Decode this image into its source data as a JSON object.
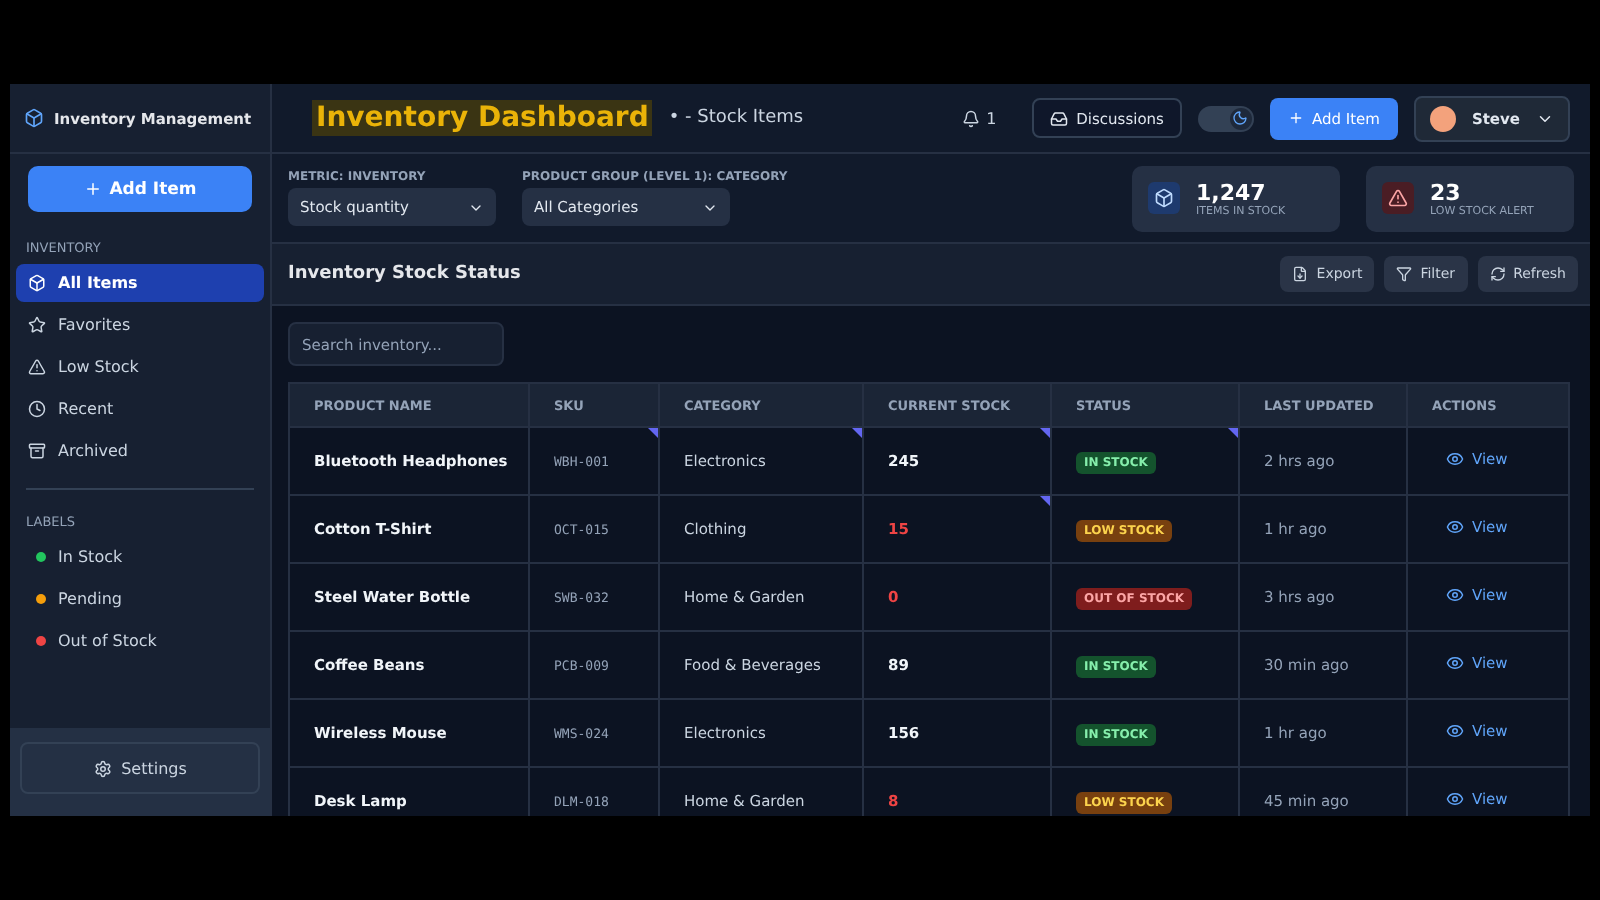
{
  "sidebar": {
    "title": "Inventory Management",
    "add_button": "Add Item",
    "sections": [
      {
        "heading": "INVENTORY",
        "kind": "nav",
        "items": [
          {
            "label": "All Items",
            "selected": true
          },
          {
            "label": "Favorites",
            "selected": false
          },
          {
            "label": "Low Stock",
            "selected": false
          },
          {
            "label": "Recent",
            "selected": false
          },
          {
            "label": "Archived",
            "selected": false
          }
        ]
      },
      {
        "heading": "LABELS",
        "kind": "labels",
        "items": [
          {
            "label": "In Stock",
            "color": "#22c55e"
          },
          {
            "label": "Pending",
            "color": "#f59e0b"
          },
          {
            "label": "Out of Stock",
            "color": "#ef4444"
          }
        ]
      }
    ],
    "settings": "Settings"
  },
  "header": {
    "title": "Inventory Dashboard",
    "subtitle": "• - Stock Items",
    "notifications": "1",
    "discussions": "Discussions",
    "dark_mode": true,
    "add_button": "Add Item",
    "user": "Steve"
  },
  "filters": [
    {
      "label": "METRIC: INVENTORY",
      "value": "Stock quantity"
    },
    {
      "label": "PRODUCT GROUP (LEVEL 1): CATEGORY",
      "value": "All Categories"
    }
  ],
  "stats": [
    {
      "kind": "stock",
      "value": "1,247",
      "label": "ITEMS IN STOCK"
    },
    {
      "kind": "alert",
      "value": "23",
      "label": "LOW STOCK ALERT"
    }
  ],
  "card": {
    "title": "Inventory Stock Status",
    "actions": [
      "Export",
      "Filter",
      "Refresh"
    ],
    "search": {
      "placeholder": "Search inventory..."
    }
  },
  "table": {
    "columns": [
      "PRODUCT NAME",
      "SKU",
      "CATEGORY",
      "CURRENT STOCK",
      "STATUS",
      "LAST UPDATED",
      "ACTIONS"
    ],
    "rows": [
      {
        "name": "Bluetooth Headphones",
        "sku": "WBH-001",
        "category": "Electronics",
        "stock": "245",
        "stock_low": false,
        "status": {
          "label": "IN STOCK",
          "kind": "in"
        },
        "updated": "2 hrs ago",
        "action": "View",
        "sku_note": true,
        "category_note": true,
        "stock_note": true,
        "status_note": true
      },
      {
        "name": "Cotton T-Shirt",
        "sku": "OCT-015",
        "category": "Clothing",
        "stock": "15",
        "stock_low": true,
        "status": {
          "label": "LOW STOCK",
          "kind": "low"
        },
        "updated": "1 hr ago",
        "action": "View",
        "sku_note": false,
        "category_note": false,
        "stock_note": true,
        "status_note": false
      },
      {
        "name": "Steel Water Bottle",
        "sku": "SWB-032",
        "category": "Home & Garden",
        "stock": "0",
        "stock_low": true,
        "status": {
          "label": "OUT OF STOCK",
          "kind": "out"
        },
        "updated": "3 hrs ago",
        "action": "View",
        "sku_note": false,
        "category_note": false,
        "stock_note": false,
        "status_note": false
      },
      {
        "name": "Coffee Beans",
        "sku": "PCB-009",
        "category": "Food & Beverages",
        "stock": "89",
        "stock_low": false,
        "status": {
          "label": "IN STOCK",
          "kind": "in"
        },
        "updated": "30 min ago",
        "action": "View",
        "sku_note": false,
        "category_note": false,
        "stock_note": false,
        "status_note": false
      },
      {
        "name": "Wireless Mouse",
        "sku": "WMS-024",
        "category": "Electronics",
        "stock": "156",
        "stock_low": false,
        "status": {
          "label": "IN STOCK",
          "kind": "in"
        },
        "updated": "1 hr ago",
        "action": "View",
        "sku_note": false,
        "category_note": false,
        "stock_note": false,
        "status_note": false
      },
      {
        "name": "Desk Lamp",
        "sku": "DLM-018",
        "category": "Home & Garden",
        "stock": "8",
        "stock_low": true,
        "status": {
          "label": "LOW STOCK",
          "kind": "low"
        },
        "updated": "45 min ago",
        "action": "View",
        "sku_note": false,
        "category_note": false,
        "stock_note": false,
        "status_note": false
      }
    ]
  }
}
